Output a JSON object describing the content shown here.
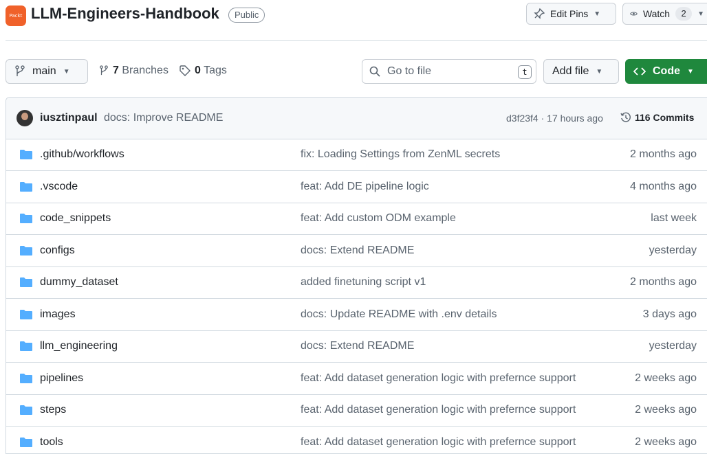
{
  "repo": {
    "logo_text": "Packt",
    "name": "LLM-Engineers-Handbook",
    "visibility": "Public"
  },
  "header_actions": {
    "edit_pins": "Edit Pins",
    "watch": "Watch",
    "watch_count": "2"
  },
  "toolbar": {
    "branch": "main",
    "branches_count": "7",
    "branches_label": "Branches",
    "tags_count": "0",
    "tags_label": "Tags",
    "search_placeholder": "Go to file",
    "search_shortcut": "t",
    "add_file": "Add file",
    "code": "Code"
  },
  "latest_commit": {
    "author": "iusztinpaul",
    "message": "docs: Improve README",
    "hash_time": "d3f23f4 · 17 hours ago",
    "commits_count": "116",
    "commits_label": "Commits"
  },
  "files": [
    {
      "name": ".github/workflows",
      "message": "fix: Loading Settings from ZenML secrets",
      "date": "2 months ago"
    },
    {
      "name": ".vscode",
      "message": "feat: Add DE pipeline logic",
      "date": "4 months ago"
    },
    {
      "name": "code_snippets",
      "message": "feat: Add custom ODM example",
      "date": "last week"
    },
    {
      "name": "configs",
      "message": "docs: Extend README",
      "date": "yesterday"
    },
    {
      "name": "dummy_dataset",
      "message": "added finetuning script v1",
      "date": "2 months ago"
    },
    {
      "name": "images",
      "message": "docs: Update README with .env details",
      "date": "3 days ago"
    },
    {
      "name": "llm_engineering",
      "message": "docs: Extend README",
      "date": "yesterday"
    },
    {
      "name": "pipelines",
      "message": "feat: Add dataset generation logic with prefernce support",
      "date": "2 weeks ago"
    },
    {
      "name": "steps",
      "message": "feat: Add dataset generation logic with prefernce support",
      "date": "2 weeks ago"
    },
    {
      "name": "tools",
      "message": "feat: Add dataset generation logic with prefernce support",
      "date": "2 weeks ago"
    }
  ],
  "colors": {
    "folder": "#54aeff",
    "code_button": "#1f883d",
    "logo": "#f0612a"
  }
}
